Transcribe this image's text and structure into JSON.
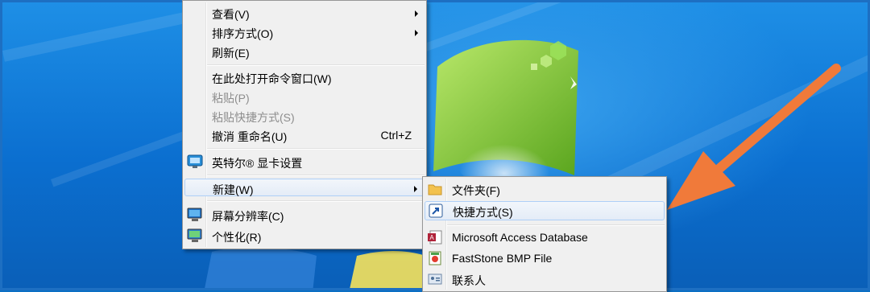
{
  "context_menu": {
    "items": [
      {
        "label": "查看(V)",
        "submenu": true,
        "disabled": false
      },
      {
        "label": "排序方式(O)",
        "submenu": true,
        "disabled": false
      },
      {
        "label": "刷新(E)",
        "submenu": false,
        "disabled": false
      },
      {
        "label": "在此处打开命令窗口(W)",
        "submenu": false,
        "disabled": false
      },
      {
        "label": "粘贴(P)",
        "submenu": false,
        "disabled": true
      },
      {
        "label": "粘贴快捷方式(S)",
        "submenu": false,
        "disabled": true
      },
      {
        "label": "撤消 重命名(U)",
        "shortcut": "Ctrl+Z",
        "submenu": false,
        "disabled": false
      },
      {
        "label": "英特尔® 显卡设置",
        "icon": "intel-graphics-icon",
        "submenu": false,
        "disabled": false
      },
      {
        "label": "新建(W)",
        "submenu": true,
        "disabled": false,
        "highlighted": true
      },
      {
        "label": "屏幕分辨率(C)",
        "icon": "display-resolution-icon",
        "submenu": false,
        "disabled": false
      },
      {
        "label": "个性化(R)",
        "icon": "personalize-icon",
        "submenu": false,
        "disabled": false
      }
    ]
  },
  "new_submenu": {
    "items": [
      {
        "label": "文件夹(F)",
        "icon": "folder-icon"
      },
      {
        "label": "快捷方式(S)",
        "icon": "shortcut-icon",
        "highlighted": true
      },
      {
        "label": "Microsoft Access Database",
        "icon": "access-db-icon"
      },
      {
        "label": "FastStone BMP File",
        "icon": "bmp-file-icon"
      },
      {
        "label": "联系人",
        "icon": "contact-icon"
      }
    ]
  },
  "colors": {
    "annotation_arrow": "#f07a3a",
    "menu_background": "#f0f0f0",
    "highlight_border": "#aecff7"
  }
}
